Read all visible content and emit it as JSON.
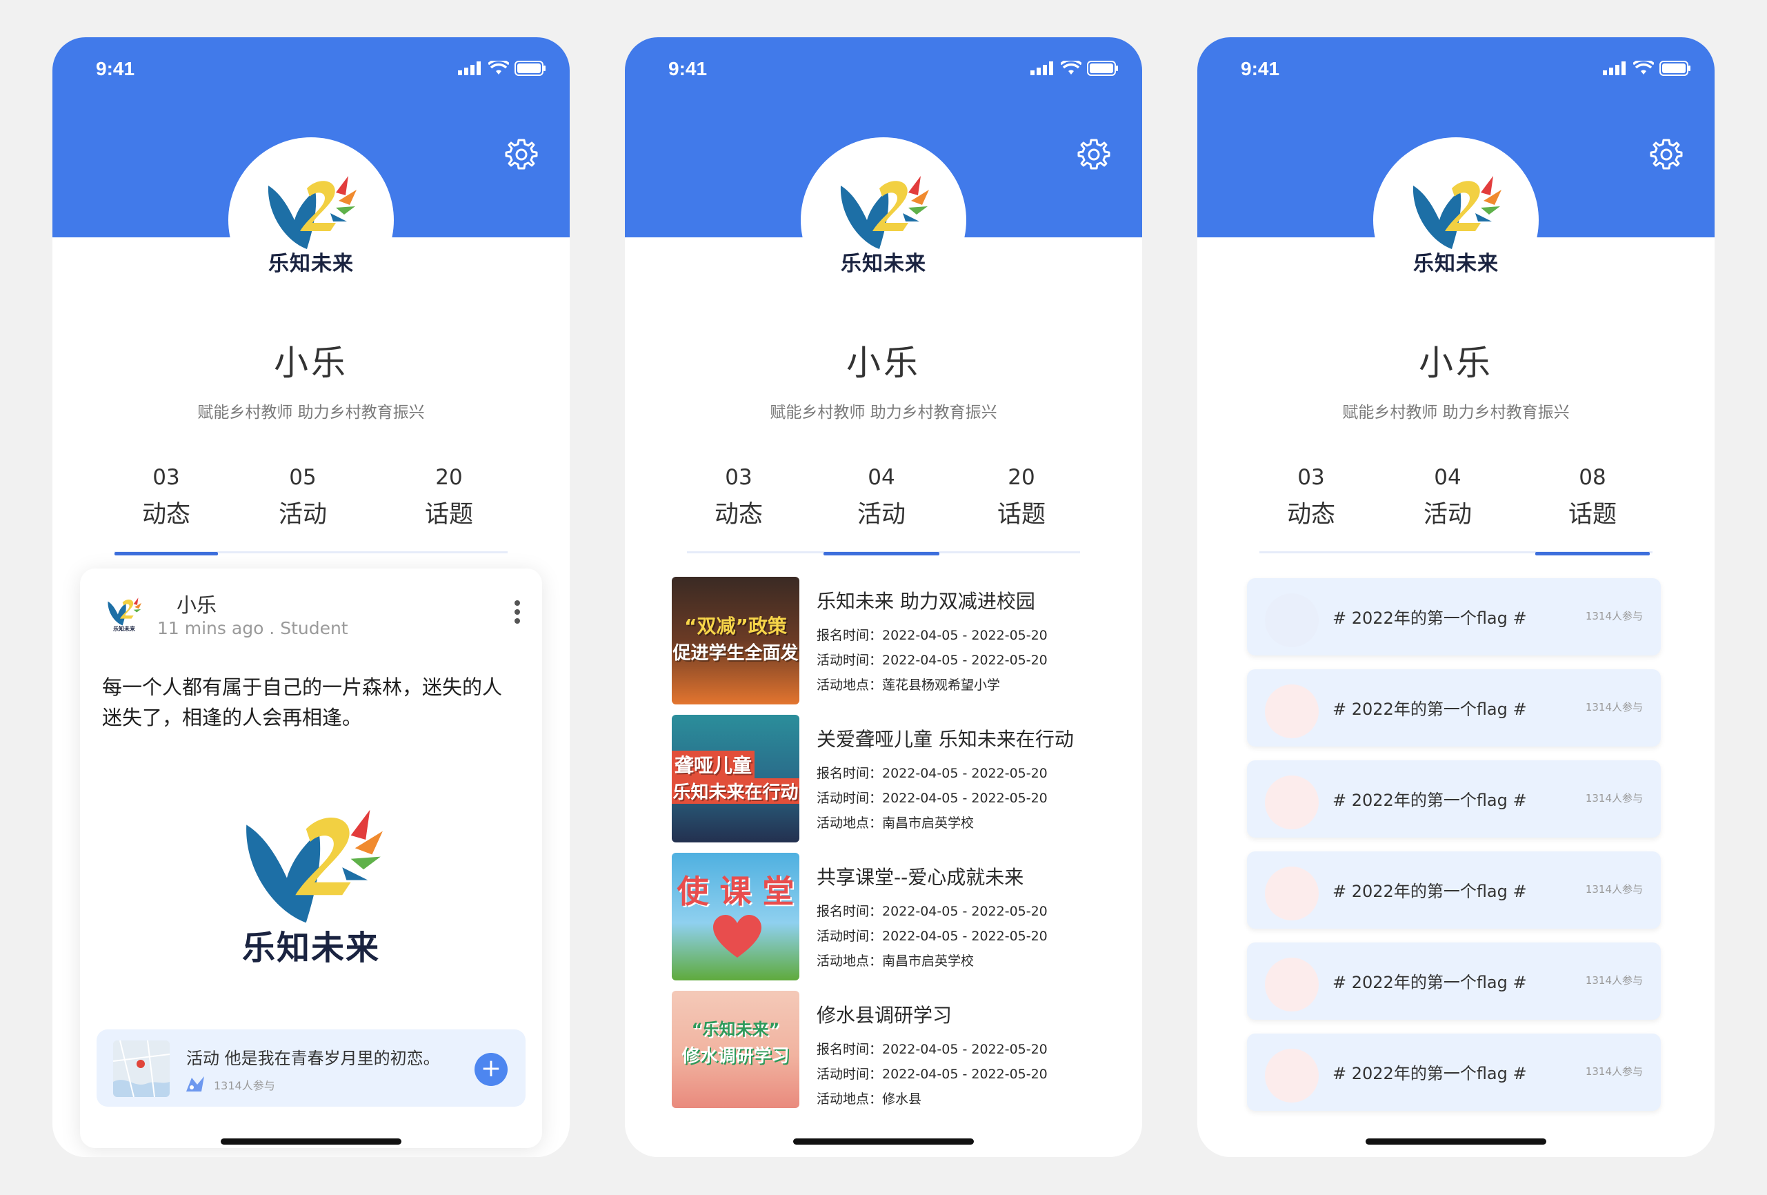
{
  "profile": {
    "status_time": "9:41",
    "brand_name": "乐知未来",
    "name": "小乐",
    "motto": "赋能乡村教师 助力乡村教育振兴"
  },
  "screens": [
    {
      "tabs": [
        {
          "num": "03",
          "label": "动态",
          "active": true
        },
        {
          "num": "05",
          "label": "活动",
          "active": false
        },
        {
          "num": "20",
          "label": "话题",
          "active": false
        }
      ]
    },
    {
      "tabs": [
        {
          "num": "03",
          "label": "动态",
          "active": false
        },
        {
          "num": "04",
          "label": "活动",
          "active": true
        },
        {
          "num": "20",
          "label": "话题",
          "active": false
        }
      ]
    },
    {
      "tabs": [
        {
          "num": "03",
          "label": "动态",
          "active": false
        },
        {
          "num": "04",
          "label": "活动",
          "active": false
        },
        {
          "num": "08",
          "label": "话题",
          "active": true
        }
      ]
    }
  ],
  "post": {
    "author": "小乐",
    "meta": "11 mins ago  .  Student",
    "text": "每一个人都有属于自己的一片森林，迷失的人迷失了，相逢的人会再相逢。",
    "image_brand": "乐知未来",
    "activity_text": "活动   他是我在青春岁月里的初恋。",
    "activity_count": "1314人参与",
    "add_symbol": "+"
  },
  "activities": [
    {
      "title": "乐知未来 助力双减进校园",
      "signup": "报名时间：2022-04-05 - 2022-05-20",
      "time": "活动时间：2022-04-05 - 2022-05-20",
      "place": "活动地点：莲花县杨观希望小学",
      "image_text_1": "“双减”政策",
      "image_text_2": "促进学生全面发",
      "color_top": "#3a2a24",
      "color_bottom": "#e3752f"
    },
    {
      "title": "关爱聋哑儿童 乐知未来在行动",
      "signup": "报名时间：2022-04-05 - 2022-05-20",
      "time": "活动时间：2022-04-05 - 2022-05-20",
      "place": "活动地点：南昌市启英学校",
      "image_text_1": "聋哑儿童",
      "image_text_2": "乐知未来在行动",
      "color_top": "#2b8e9b",
      "color_bottom": "#23304f"
    },
    {
      "title": "共享课堂--爱心成就未来",
      "signup": "报名时间：2022-04-05 - 2022-05-20",
      "time": "活动时间：2022-04-05 - 2022-05-20",
      "place": "活动地点：南昌市启英学校",
      "image_text_1": "使 课 堂",
      "image_text_2": "",
      "color_top": "#4fb0e0",
      "color_bottom": "#5faa3c"
    },
    {
      "title": "修水县调研学习",
      "signup": "报名时间：2022-04-05 - 2022-05-20",
      "time": "活动时间：2022-04-05 - 2022-05-20",
      "place": "活动地点：修水县",
      "image_text_1": "“乐知未来”",
      "image_text_2": "修水调研学习",
      "color_top": "#f4c9b8",
      "color_bottom": "#e98a7d"
    }
  ],
  "topics": [
    {
      "title": "# 2022年的第一个flag #",
      "count": "1314人参与"
    },
    {
      "title": "# 2022年的第一个flag #",
      "count": "1314人参与"
    },
    {
      "title": "# 2022年的第一个flag #",
      "count": "1314人参与"
    },
    {
      "title": "# 2022年的第一个flag #",
      "count": "1314人参与"
    },
    {
      "title": "# 2022年的第一个flag #",
      "count": "1314人参与"
    },
    {
      "title": "# 2022年的第一个flag #",
      "count": "1314人参与"
    }
  ],
  "colors": {
    "header_blue": "#417aea",
    "tab_underline": "#3d6fdc",
    "card_tint": "#eaf2fe"
  }
}
